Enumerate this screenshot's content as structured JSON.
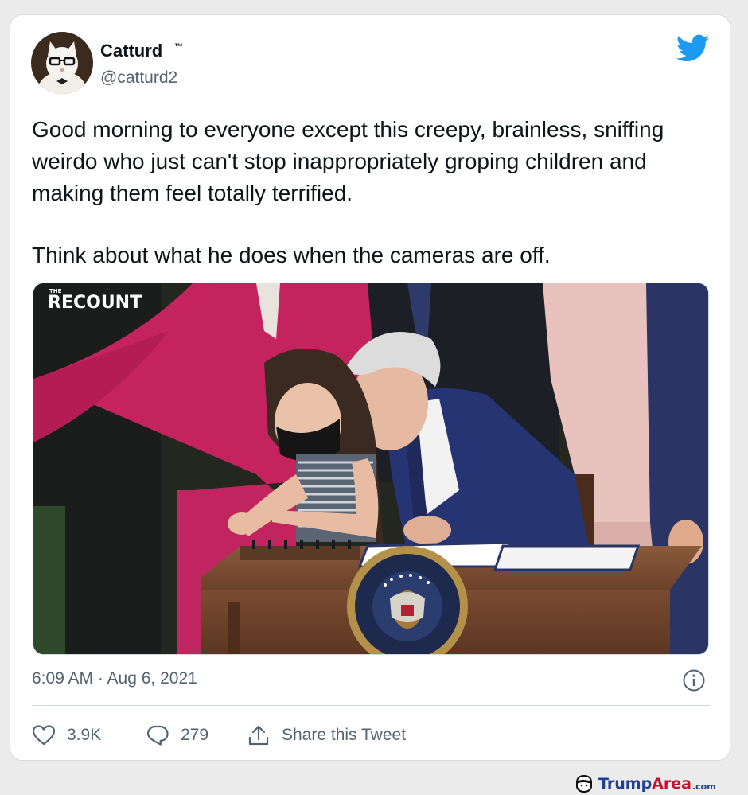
{
  "tweet": {
    "display_name": "Catturd",
    "trademark": "™",
    "handle": "@catturd2",
    "paragraphs": [
      "Good morning to everyone except this creepy, brainless, sniffing weirdo who just can't stop inappropriately groping children and making them feel totally terrified.",
      "Think about what he does when the cameras are off."
    ],
    "media": {
      "watermark_top": "THE",
      "watermark_main": "RECOUNT"
    },
    "timestamp": "6:09 AM · Aug 6, 2021",
    "likes": "3.9K",
    "replies": "279",
    "share_label": "Share this Tweet"
  },
  "footer": {
    "brand_left": "Trump",
    "brand_right": "Area",
    "brand_suffix": ".com"
  },
  "colors": {
    "twitter_blue": "#1d9bf0",
    "text_primary": "#0f1419",
    "text_secondary": "#536471"
  },
  "icons": [
    "twitter-bird-icon",
    "info-icon",
    "heart-icon",
    "reply-icon",
    "share-icon",
    "trumparea-logo-icon"
  ]
}
